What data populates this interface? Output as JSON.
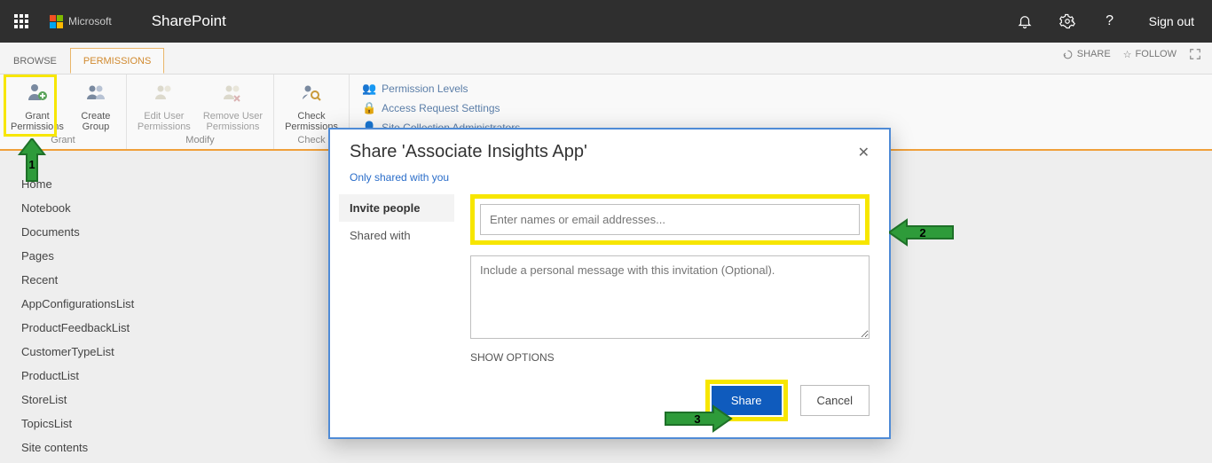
{
  "topbar": {
    "vendor": "Microsoft",
    "app": "SharePoint",
    "signout": "Sign out"
  },
  "tabs": {
    "browse": "BROWSE",
    "permissions": "PERMISSIONS"
  },
  "tabActions": {
    "share": "SHARE",
    "follow": "FOLLOW"
  },
  "ribbon": {
    "grant": {
      "grant_permissions": "Grant\nPermissions",
      "create_group": "Create\nGroup",
      "label": "Grant"
    },
    "modify": {
      "edit_user": "Edit User\nPermissions",
      "remove_user": "Remove User\nPermissions",
      "label": "Modify"
    },
    "check": {
      "check_permissions": "Check\nPermissions",
      "label": "Check"
    },
    "links": {
      "permission_levels": "Permission Levels",
      "access_request": "Access Request Settings",
      "site_collection_admins": "Site Collection Administrators"
    }
  },
  "sidebar": {
    "items": [
      "Home",
      "Notebook",
      "Documents",
      "Pages",
      "Recent",
      "AppConfigurationsList",
      "ProductFeedbackList",
      "CustomerTypeList",
      "ProductList",
      "StoreList",
      "TopicsList",
      "Site contents"
    ]
  },
  "dialog": {
    "title": "Share 'Associate Insights App'",
    "shared_with_link": "Only shared with you",
    "tabs": {
      "invite": "Invite people",
      "shared_with": "Shared with"
    },
    "names_placeholder": "Enter names or email addresses...",
    "message_placeholder": "Include a personal message with this invitation (Optional).",
    "show_options": "SHOW OPTIONS",
    "share_btn": "Share",
    "cancel_btn": "Cancel"
  },
  "annotations": {
    "one": "1",
    "two": "2",
    "three": "3"
  }
}
